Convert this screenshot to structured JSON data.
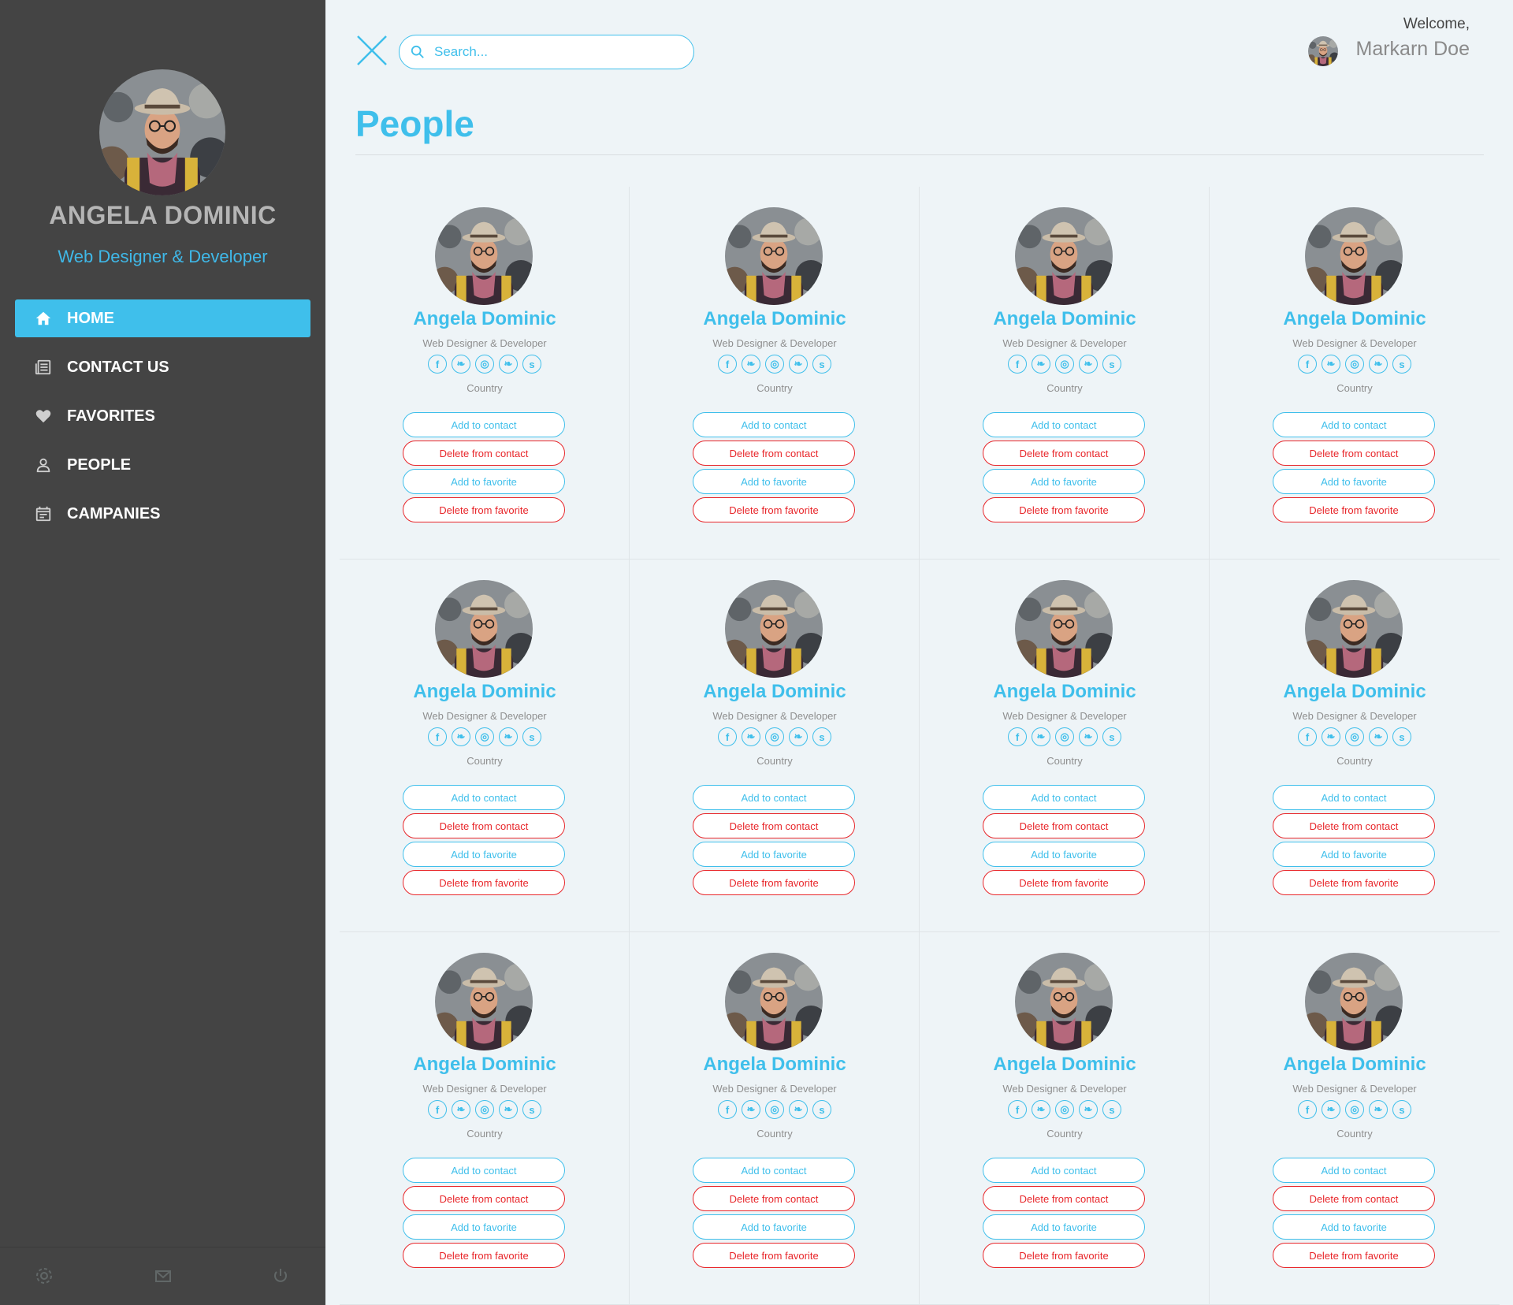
{
  "sidebar": {
    "profile": {
      "name": "ANGELA DOMINIC",
      "role": "Web Designer & Developer",
      "avatar_icon": "user-photo"
    },
    "nav": [
      {
        "label": "HOME",
        "icon": "home-icon",
        "active": true
      },
      {
        "label": "CONTACT US",
        "icon": "newspaper-icon",
        "active": false
      },
      {
        "label": "FAVORITES",
        "icon": "heart-icon",
        "active": false
      },
      {
        "label": "PEOPLE",
        "icon": "person-icon",
        "active": false
      },
      {
        "label": "CAMPANIES",
        "icon": "calendar-icon",
        "active": false
      }
    ],
    "footer_icons": [
      "gear-icon",
      "mail-icon",
      "power-icon"
    ]
  },
  "header": {
    "search_placeholder": "Search...",
    "welcome": "Welcome,",
    "user_name": "Markarn Doe"
  },
  "page": {
    "title": "People"
  },
  "colors": {
    "accent": "#3fbfeb",
    "danger": "#e8262a",
    "sidebar_bg": "#444444",
    "page_bg": "#eef4f7"
  },
  "people": [
    {
      "name": "Angela Dominic",
      "role": "Web Designer & Developer",
      "country": "Country",
      "buttons": {
        "add_contact": "Add to contact",
        "delete_contact": "Delete from contact",
        "add_favorite": "Add to favorite",
        "delete_favorite": "Delete from favorite"
      }
    },
    {
      "name": "Angela Dominic",
      "role": "Web Designer & Developer",
      "country": "Country",
      "buttons": {
        "add_contact": "Add to contact",
        "delete_contact": "Delete from contact",
        "add_favorite": "Add to favorite",
        "delete_favorite": "Delete from favorite"
      }
    },
    {
      "name": "Angela Dominic",
      "role": "Web Designer & Developer",
      "country": "Country",
      "buttons": {
        "add_contact": "Add to contact",
        "delete_contact": "Delete from contact",
        "add_favorite": "Add to favorite",
        "delete_favorite": "Delete from favorite"
      }
    },
    {
      "name": "Angela Dominic",
      "role": "Web Designer & Developer",
      "country": "Country",
      "buttons": {
        "add_contact": "Add to contact",
        "delete_contact": "Delete from contact",
        "add_favorite": "Add to favorite",
        "delete_favorite": "Delete from favorite"
      }
    },
    {
      "name": "Angela Dominic",
      "role": "Web Designer & Developer",
      "country": "Country",
      "buttons": {
        "add_contact": "Add to contact",
        "delete_contact": "Delete from contact",
        "add_favorite": "Add to favorite",
        "delete_favorite": "Delete from favorite"
      }
    },
    {
      "name": "Angela Dominic",
      "role": "Web Designer & Developer",
      "country": "Country",
      "buttons": {
        "add_contact": "Add to contact",
        "delete_contact": "Delete from contact",
        "add_favorite": "Add to favorite",
        "delete_favorite": "Delete from favorite"
      }
    },
    {
      "name": "Angela Dominic",
      "role": "Web Designer & Developer",
      "country": "Country",
      "buttons": {
        "add_contact": "Add to contact",
        "delete_contact": "Delete from contact",
        "add_favorite": "Add to favorite",
        "delete_favorite": "Delete from favorite"
      }
    },
    {
      "name": "Angela Dominic",
      "role": "Web Designer & Developer",
      "country": "Country",
      "buttons": {
        "add_contact": "Add to contact",
        "delete_contact": "Delete from contact",
        "add_favorite": "Add to favorite",
        "delete_favorite": "Delete from favorite"
      }
    },
    {
      "name": "Angela Dominic",
      "role": "Web Designer & Developer",
      "country": "Country",
      "buttons": {
        "add_contact": "Add to contact",
        "delete_contact": "Delete from contact",
        "add_favorite": "Add to favorite",
        "delete_favorite": "Delete from favorite"
      }
    },
    {
      "name": "Angela Dominic",
      "role": "Web Designer & Developer",
      "country": "Country",
      "buttons": {
        "add_contact": "Add to contact",
        "delete_contact": "Delete from contact",
        "add_favorite": "Add to favorite",
        "delete_favorite": "Delete from favorite"
      }
    },
    {
      "name": "Angela Dominic",
      "role": "Web Designer & Developer",
      "country": "Country",
      "buttons": {
        "add_contact": "Add to contact",
        "delete_contact": "Delete from contact",
        "add_favorite": "Add to favorite",
        "delete_favorite": "Delete from favorite"
      }
    },
    {
      "name": "Angela Dominic",
      "role": "Web Designer & Developer",
      "country": "Country",
      "buttons": {
        "add_contact": "Add to contact",
        "delete_contact": "Delete from contact",
        "add_favorite": "Add to favorite",
        "delete_favorite": "Delete from favorite"
      }
    }
  ]
}
